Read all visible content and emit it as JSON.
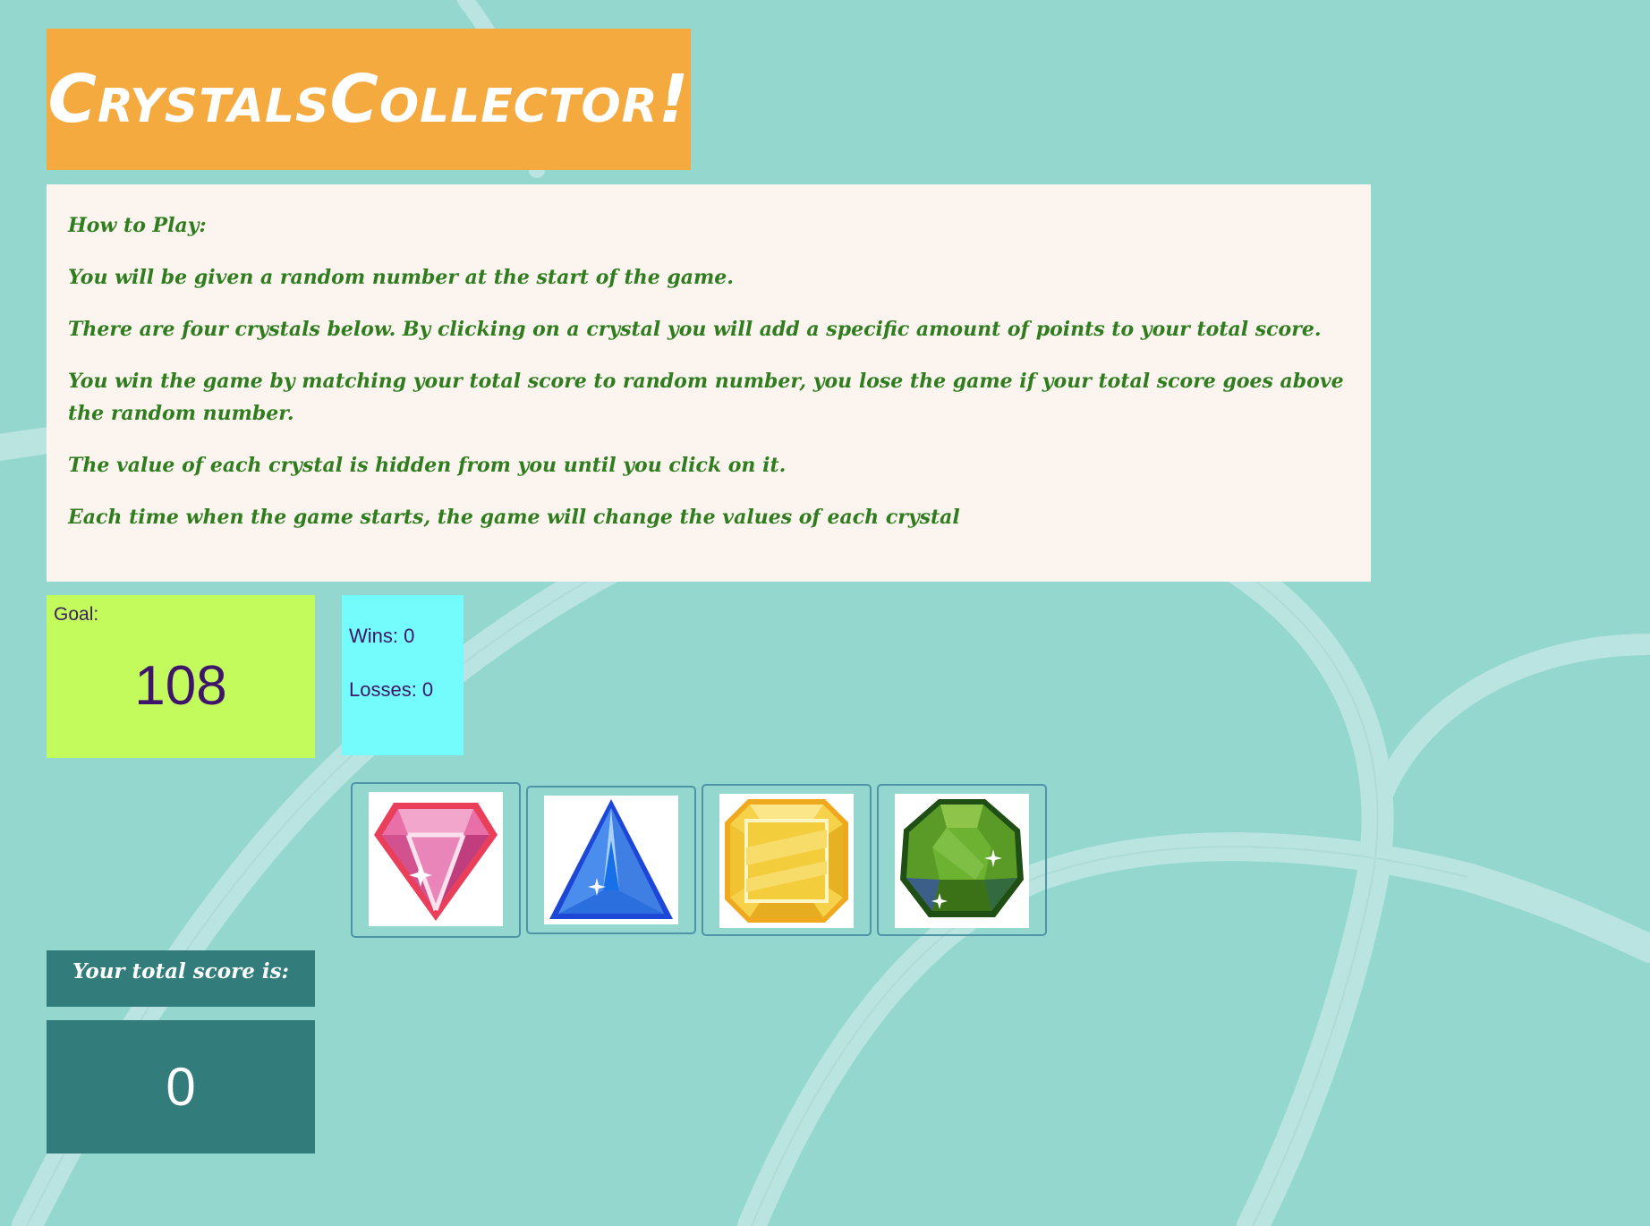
{
  "header": {
    "title": "CrystalsCollector!"
  },
  "instructions": {
    "paragraphs": [
      "How to Play:",
      "You will be given a random number at the start of the game.",
      "There are four crystals below. By clicking on a crystal you will add a specific amount of points to your total score.",
      "You win the game by matching your total score to random number, you lose the game if your total score goes above the random number.",
      "The value of each crystal is hidden from you until you click on it.",
      "Each time when the game starts, the game will change the values of each crystal"
    ]
  },
  "goal": {
    "label": "Goal:",
    "value": "108"
  },
  "stats": {
    "wins": "Wins: 0",
    "losses": "Losses: 0"
  },
  "crystals": [
    {
      "name": "pink-diamond-crystal",
      "color": "#e0508a"
    },
    {
      "name": "blue-triangle-crystal",
      "color": "#2f72e8"
    },
    {
      "name": "yellow-octagon-crystal",
      "color": "#f2c73a"
    },
    {
      "name": "green-round-crystal",
      "color": "#5a9a27"
    }
  ],
  "score": {
    "label": "Your total score is:",
    "value": "0"
  },
  "colors": {
    "background": "#93d7cf",
    "title_bg": "#f4aa3f",
    "instructions_text": "#2f7d1e",
    "goal_bg": "#c2fb5b",
    "stats_bg": "#73fcfb",
    "score_bg": "#327c7c"
  }
}
